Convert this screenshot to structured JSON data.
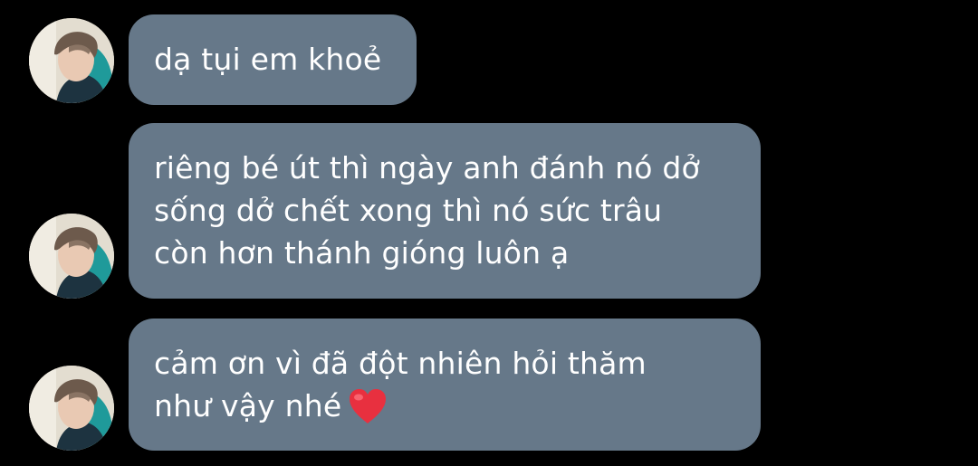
{
  "messages": [
    {
      "lines": [
        "dạ tụi em khoẻ"
      ]
    },
    {
      "lines": [
        "riêng bé út thì ngày anh đánh nó dở",
        "sống dở chết xong thì nó sức trâu",
        "còn hơn thánh gióng luôn ạ"
      ]
    },
    {
      "lines": [
        "cảm ơn vì đã đột nhiên hỏi thăm",
        "như vậy nhé"
      ],
      "trailing_emoji": "heart-icon"
    }
  ],
  "colors": {
    "background": "#000000",
    "bubble": "#667889",
    "text": "#ffffff",
    "heart": "#e8303f"
  }
}
